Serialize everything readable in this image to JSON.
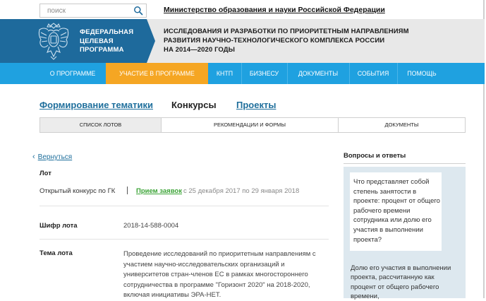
{
  "search": {
    "placeholder": "поиск"
  },
  "ministry_link": "Министерство образования и науки Российской Федерации",
  "header": {
    "logo_lines": [
      "ФЕДЕРАЛЬНАЯ",
      "ЦЕЛЕВАЯ",
      "ПРОГРАММА"
    ],
    "program_title_lines": [
      "ИССЛЕДОВАНИЯ И РАЗРАБОТКИ ПО ПРИОРИТЕТНЫМ НАПРАВЛЕНИЯМ",
      "РАЗВИТИЯ НАУЧНО-ТЕХНОЛОГИЧЕСКОГО КОМПЛЕКСА РОССИИ",
      "НА 2014—2020 ГОДЫ"
    ]
  },
  "nav": {
    "items": [
      {
        "label": "О ПРОГРАММЕ",
        "active": false
      },
      {
        "label": "УЧАСТИЕ В ПРОГРАММЕ",
        "active": true
      },
      {
        "label": "КНТП",
        "active": false
      },
      {
        "label": "БИЗНЕСУ",
        "active": false
      },
      {
        "label": "ДОКУМЕНТЫ",
        "active": false
      },
      {
        "label": "СОБЫТИЯ",
        "active": false
      },
      {
        "label": "ПОМОЩЬ",
        "active": false
      }
    ],
    "accent_color": "#1fa1e0",
    "active_color": "#f5a623"
  },
  "subtabs": [
    {
      "label": "Формирование тематики",
      "current": false
    },
    {
      "label": "Конкурсы",
      "current": true
    },
    {
      "label": "Проекты",
      "current": false
    }
  ],
  "section_tabs": [
    {
      "label": "СПИСОК ЛОТОВ",
      "active": true
    },
    {
      "label": "РЕКОМЕНДАЦИИ И ФОРМЫ",
      "active": false
    },
    {
      "label": "ДОКУМЕНТЫ",
      "active": false
    }
  ],
  "main": {
    "back_label": "Вернуться",
    "lot_heading": "Лот",
    "competition_type": "Открытый конкурс по ГК",
    "status": "Прием заявок",
    "date_range": "с 25 декабря 2017 по 29 января 2018",
    "fields": [
      {
        "label": "Шифр лота",
        "value": "2018-14-588-0004"
      },
      {
        "label": "Тема лота",
        "value": "Проведение исследований по приоритетным направлениям с участием научно-исследовательских организаций и университетов стран-членов ЕС в рамках многостороннего сотрудничества в программе \"Горизонт 2020\" на 2018-2020, включая инициативы ЭРА-НЕТ."
      }
    ]
  },
  "sidebar": {
    "title": "Вопросы и ответы",
    "question": "Что представляет собой степень занятости в проекте: процент от общего рабочего времени сотрудника или долю его участия в выполнении проекта?",
    "answer": "Долю его участия в выполнении проекта, рассчитанную как процент от общего рабочего времени,"
  }
}
